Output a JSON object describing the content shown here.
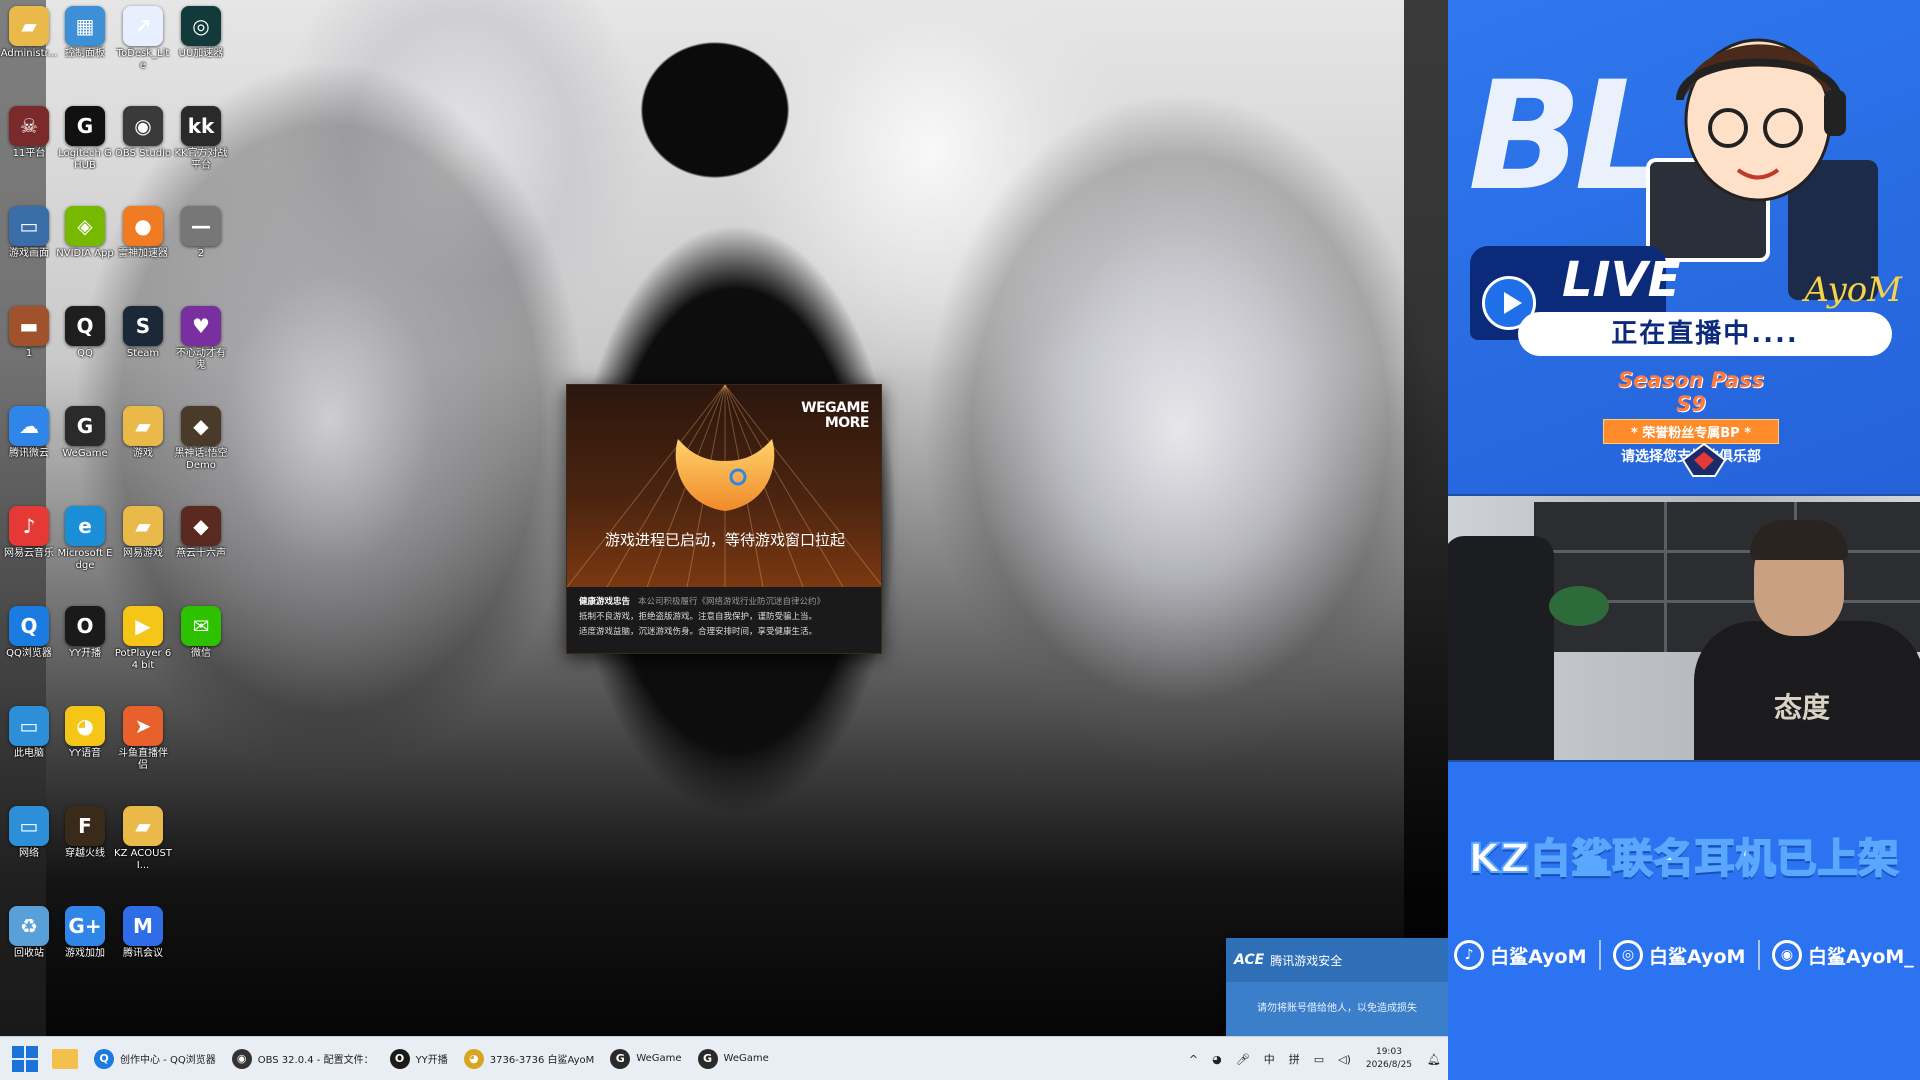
{
  "desktop": {
    "icons": [
      {
        "label": "Administr...",
        "color": "#e9b949",
        "glyph": "▰",
        "icon": "folder-icon"
      },
      {
        "label": "控制面板",
        "color": "#3d8fd6",
        "glyph": "▦",
        "icon": "control-panel-icon"
      },
      {
        "label": "ToDesk_Lite",
        "color": "#e8f0ff",
        "glyph": "↗",
        "icon": "todesk-icon"
      },
      {
        "label": "UU加速器",
        "color": "#133a3a",
        "glyph": "◎",
        "icon": "uu-accelerator-icon"
      },
      {
        "label": "11平台",
        "color": "#7a2a2a",
        "glyph": "☠",
        "icon": "11-platform-icon"
      },
      {
        "label": "Logitech G HUB",
        "color": "#111111",
        "glyph": "G",
        "icon": "logitech-ghub-icon"
      },
      {
        "label": "OBS Studio",
        "color": "#3a3a3a",
        "glyph": "◉",
        "icon": "obs-icon"
      },
      {
        "label": "KK官方对战平台",
        "color": "#2a2a2a",
        "glyph": "kk",
        "icon": "kk-platform-icon"
      },
      {
        "label": "游戏画面",
        "color": "#3a6ea8",
        "glyph": "▭",
        "icon": "game-screen-icon"
      },
      {
        "label": "NVIDIA App",
        "color": "#76b900",
        "glyph": "◈",
        "icon": "nvidia-icon"
      },
      {
        "label": "雷神加速器",
        "color": "#f07b22",
        "glyph": "●",
        "icon": "leishen-accelerator-icon"
      },
      {
        "label": "2",
        "color": "#777777",
        "glyph": "—",
        "icon": "shortcut-icon"
      },
      {
        "label": "1",
        "color": "#a0522d",
        "glyph": "▬",
        "icon": "shortcut-icon"
      },
      {
        "label": "QQ",
        "color": "#1e1e1e",
        "glyph": "Q",
        "icon": "qq-icon"
      },
      {
        "label": "Steam",
        "color": "#1b2838",
        "glyph": "S",
        "icon": "steam-icon"
      },
      {
        "label": "不心动才有鬼",
        "color": "#7a2fa0",
        "glyph": "♥",
        "icon": "game-icon"
      },
      {
        "label": "腾讯微云",
        "color": "#2f86e8",
        "glyph": "☁",
        "icon": "weiyun-icon"
      },
      {
        "label": "WeGame",
        "color": "#2a2a2a",
        "glyph": "G",
        "icon": "wegame-icon"
      },
      {
        "label": "游戏",
        "color": "#e9b949",
        "glyph": "▰",
        "icon": "folder-icon"
      },
      {
        "label": "黑神话:悟空 Demo",
        "color": "#4a3a2a",
        "glyph": "◆",
        "icon": "game-demo-icon"
      },
      {
        "label": "网易云音乐",
        "color": "#e53935",
        "glyph": "♪",
        "icon": "netease-music-icon"
      },
      {
        "label": "Microsoft Edge",
        "color": "#1a8ed6",
        "glyph": "e",
        "icon": "edge-icon"
      },
      {
        "label": "网易游戏",
        "color": "#e9b949",
        "glyph": "▰",
        "icon": "folder-icon"
      },
      {
        "label": "燕云十六声",
        "color": "#5a2a20",
        "glyph": "◆",
        "icon": "game-icon"
      },
      {
        "label": "QQ浏览器",
        "color": "#1a7be0",
        "glyph": "Q",
        "icon": "qq-browser-icon"
      },
      {
        "label": "YY开播",
        "color": "#1a1a1a",
        "glyph": "O",
        "icon": "yy-live-icon"
      },
      {
        "label": "PotPlayer 64 bit",
        "color": "#f5c518",
        "glyph": "▶",
        "icon": "potplayer-icon"
      },
      {
        "label": "微信",
        "color": "#2dc100",
        "glyph": "✉",
        "icon": "wechat-icon"
      },
      {
        "label": "此电脑",
        "color": "#2c8fd8",
        "glyph": "▭",
        "icon": "this-pc-icon"
      },
      {
        "label": "YY语音",
        "color": "#f5c518",
        "glyph": "◕",
        "icon": "yy-voice-icon"
      },
      {
        "label": "斗鱼直播伴侣",
        "color": "#e8612c",
        "glyph": "➤",
        "icon": "douyu-icon"
      },
      {
        "label": "网络",
        "color": "#2c8fd8",
        "glyph": "▭",
        "icon": "network-icon"
      },
      {
        "label": "穿越火线",
        "color": "#3a2a1a",
        "glyph": "F",
        "icon": "crossfire-icon"
      },
      {
        "label": "KZ ACOUSTI...",
        "color": "#e9b949",
        "glyph": "▰",
        "icon": "folder-icon"
      },
      {
        "label": "回收站",
        "color": "#5aa0d8",
        "glyph": "♻",
        "icon": "recycle-bin-icon"
      },
      {
        "label": "游戏加加",
        "color": "#2f86e8",
        "glyph": "G+",
        "icon": "game-plus-icon"
      },
      {
        "label": "腾讯会议",
        "color": "#2f6de8",
        "glyph": "M",
        "icon": "tencent-meeting-icon"
      }
    ]
  },
  "wegame_dialog": {
    "brand_line1": "WEGAME",
    "brand_line2": "MORE",
    "message": "游戏进程已启动，等待游戏窗口拉起",
    "notice_heading": "健康游戏忠告",
    "notice_sub": "本公司积极履行《网络游戏行业防沉迷自律公约》",
    "notice_line1": "抵制不良游戏，拒绝盗版游戏。注意自我保护，谨防受骗上当。",
    "notice_line2": "适度游戏益脑，沉迷游戏伤身。合理安排时间，享受健康生活。"
  },
  "ace_toast": {
    "logo": "ACE",
    "title": "腾讯游戏安全",
    "body": "请勿将账号借给他人，以免造成损失"
  },
  "taskbar": {
    "apps": [
      {
        "label": "创作中心 - QQ浏览器",
        "color": "#1a7be0",
        "glyph": "Q"
      },
      {
        "label": "OBS 32.0.4 - 配置文件：",
        "color": "#333333",
        "glyph": "◉"
      },
      {
        "label": "YY开播",
        "color": "#1a1a1a",
        "glyph": "O"
      },
      {
        "label": "3736-3736 白鲨AyoM",
        "color": "#d9a520",
        "glyph": "◕"
      },
      {
        "label": "WeGame",
        "color": "#2a2a2a",
        "glyph": "G"
      },
      {
        "label": "WeGame",
        "color": "#2a2a2a",
        "glyph": "G"
      }
    ],
    "tray": {
      "chevron": "^",
      "lang1": "中",
      "lang2": "拼",
      "time": "19:03",
      "date": "2026/8/25"
    }
  },
  "overlay": {
    "big_letters": "BL",
    "live_label": "LIVE",
    "live_status": "正在直播中....",
    "signature": "AyoM",
    "season_title": "Season Pass S9",
    "season_ribbon": "* 荣誉粉丝专属BP *",
    "season_sub": "请选择您支持的俱乐部",
    "shirt_text": "态度",
    "promo": "KZ白鲨联名耳机已上架",
    "socials": [
      {
        "platform": "tiktok-icon",
        "glyph": "♪",
        "handle": "白鲨AyoM"
      },
      {
        "platform": "kuaishou-icon",
        "glyph": "◎",
        "handle": "白鲨AyoM"
      },
      {
        "platform": "weibo-icon",
        "glyph": "◉",
        "handle": "白鲨AyoM_"
      }
    ]
  }
}
